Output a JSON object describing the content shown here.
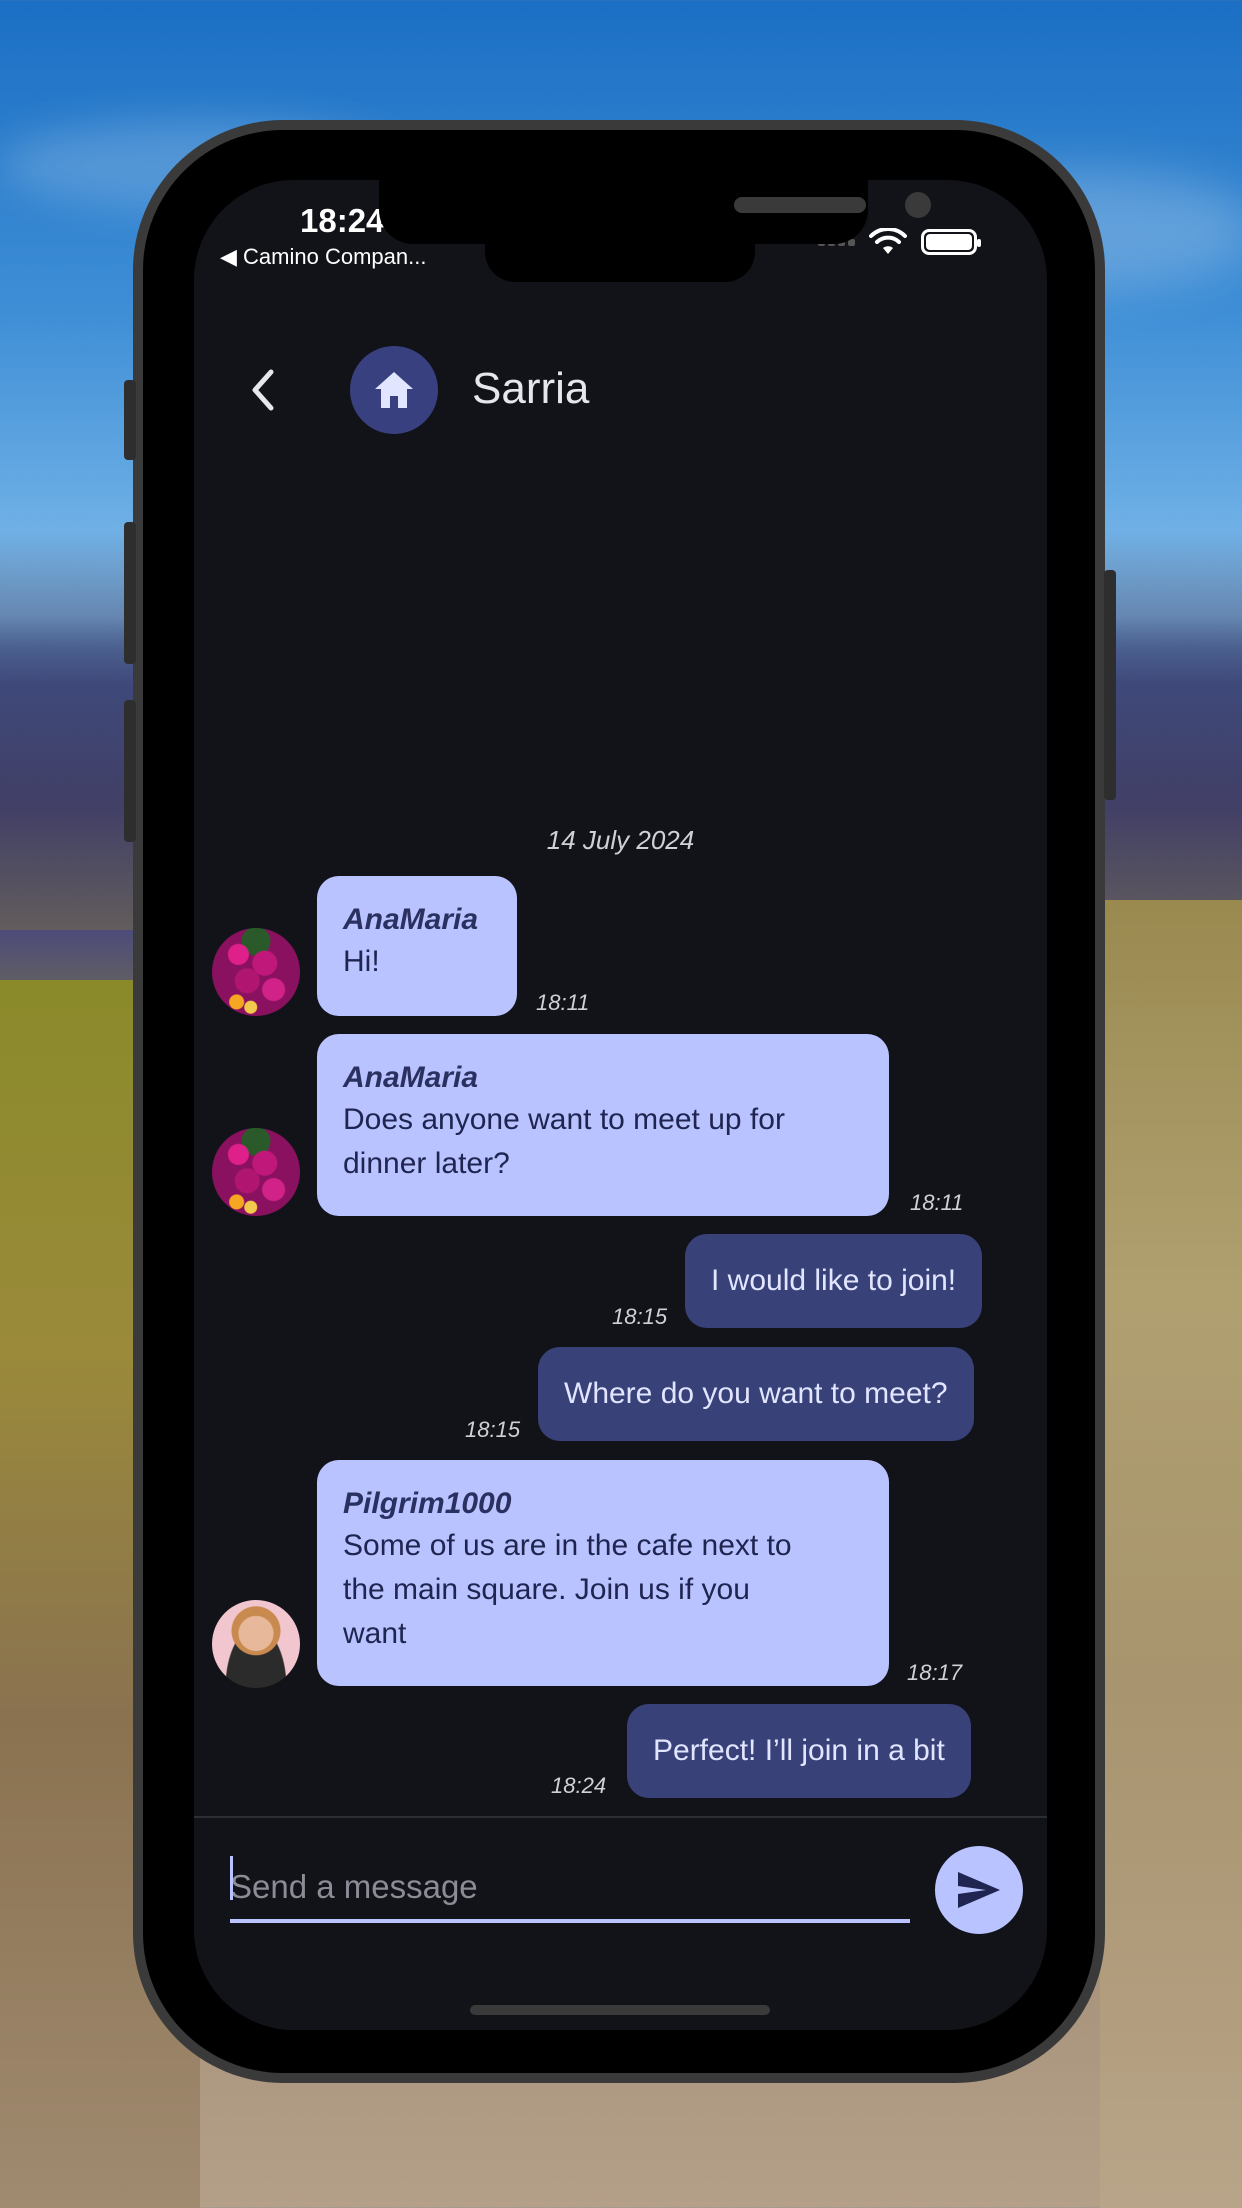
{
  "status_bar": {
    "time": "18:24",
    "back_app": "◀ Camino Compan..."
  },
  "header": {
    "back_icon": "chevron-left-icon",
    "room_icon": "home-icon",
    "title": "Sarria"
  },
  "chat": {
    "date_separator": "14 July 2024",
    "messages": [
      {
        "direction": "incoming",
        "sender": "AnaMaria",
        "text": "Hi!",
        "time": "18:11",
        "avatar": "flowers"
      },
      {
        "direction": "incoming",
        "sender": "AnaMaria",
        "text_lines": [
          "Does anyone want to meet up for",
          "dinner later?"
        ],
        "time": "18:11",
        "avatar": "flowers"
      },
      {
        "direction": "outgoing",
        "text": "I would like to join!",
        "time": "18:15"
      },
      {
        "direction": "outgoing",
        "text": "Where do you want to meet?",
        "time": "18:15"
      },
      {
        "direction": "incoming",
        "sender": "Pilgrim1000",
        "text_lines": [
          "Some of us are in the cafe next to",
          "the main square. Join us if you",
          "want"
        ],
        "time": "18:17",
        "avatar": "person"
      },
      {
        "direction": "outgoing",
        "text": "Perfect! I’ll join in a bit",
        "time": "18:24"
      }
    ]
  },
  "composer": {
    "placeholder": "Send a message",
    "send_icon": "send-icon"
  },
  "colors": {
    "background": "#121318",
    "incoming_bubble": "#b9c3ff",
    "outgoing_bubble": "#384279",
    "accent": "#b9c3ff"
  }
}
